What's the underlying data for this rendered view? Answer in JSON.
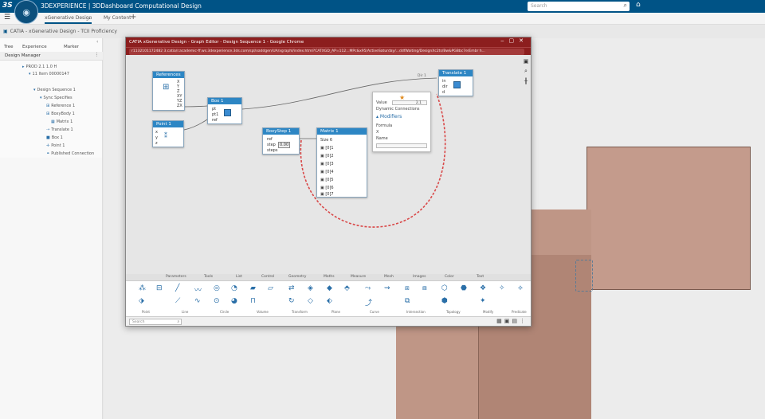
{
  "topbar": {
    "brand": "3S",
    "title": "3DEXPERIENCE | 3DDashboard  Computational Design",
    "search_placeholder": "Search"
  },
  "tabs": {
    "active": "xGenerative Design",
    "other": "My Content",
    "add": "+"
  },
  "breadcrumb": "CATIA - xGenerative Design - TCII Proficiency",
  "left_panel": {
    "tabs": [
      "Tree",
      "Experience",
      "Marker"
    ],
    "header": "Design Manager",
    "items": [
      "PROD 2.1 1.0 H",
      "11 Item 00000147",
      "Design Sequence 1",
      "Sync Specifies",
      "Reference 1",
      "BoxyBody 1",
      "Matrix 1",
      "Translate 1",
      "Box 1",
      "Point 1",
      "Published Connection"
    ]
  },
  "window": {
    "title": "CATIA xGenerative Design - Graph Editor - Design Sequence 1 - Google Chrome",
    "url": "r1132101172482 3.catia/r.academic-ff.ws.3dexperience.3ds.com/spl/xaddgen/UA/xgraphl/index.html?CATXGD_AP=112...MPc&x95/ActiveSaturday/...ddfWaiting/DesignXc2ts/Bw&PGBbc7e/Embr h..."
  },
  "nodes": {
    "references": {
      "title": "References",
      "ports": [
        "X",
        "Y",
        "Z",
        "XY",
        "YZ",
        "ZX"
      ]
    },
    "point": {
      "title": "Point 1",
      "ports": [
        "x",
        "y",
        "z"
      ]
    },
    "box": {
      "title": "Box 1",
      "ports": [
        "pt",
        "pt1",
        "ref"
      ]
    },
    "boxystep": {
      "title": "BoxyStep 1",
      "ports": [
        "ref",
        "step",
        "steps"
      ],
      "value": "0.00"
    },
    "matrix": {
      "title": "Matrix 1",
      "ports": [
        "Size 6",
        "[0]1",
        "[0]2",
        "[0]3",
        "[0]4",
        "[0]5",
        "[0]6",
        "[0]7"
      ]
    },
    "translate": {
      "title": "Translate 1",
      "ports": [
        "in",
        "dir",
        "d"
      ]
    },
    "link_label": "Dir 1"
  },
  "popup": {
    "value_label": "Value",
    "value": "2.1",
    "dynamic": "Dynamic Connections",
    "modifiers": "Modifiers",
    "formula": "Formula",
    "x": "X",
    "name": "Name"
  },
  "palette": {
    "tabs": [
      "Parameters",
      "Tools",
      "List",
      "Control",
      "Geometry",
      "Maths",
      "Measure",
      "Mesh",
      "Images",
      "Color",
      "Text"
    ],
    "groups": [
      "Point",
      "Line",
      "Circle",
      "Volume",
      "Transform",
      "Plane",
      "Curve",
      "Intersection",
      "Topology",
      "Modify",
      "Predicate"
    ]
  },
  "search_placeholder": "Search",
  "colors": {
    "topbar": "#005386",
    "window_title": "#8c1e1e",
    "node_header": "#2d86c4",
    "cube": "#c49b8c"
  }
}
